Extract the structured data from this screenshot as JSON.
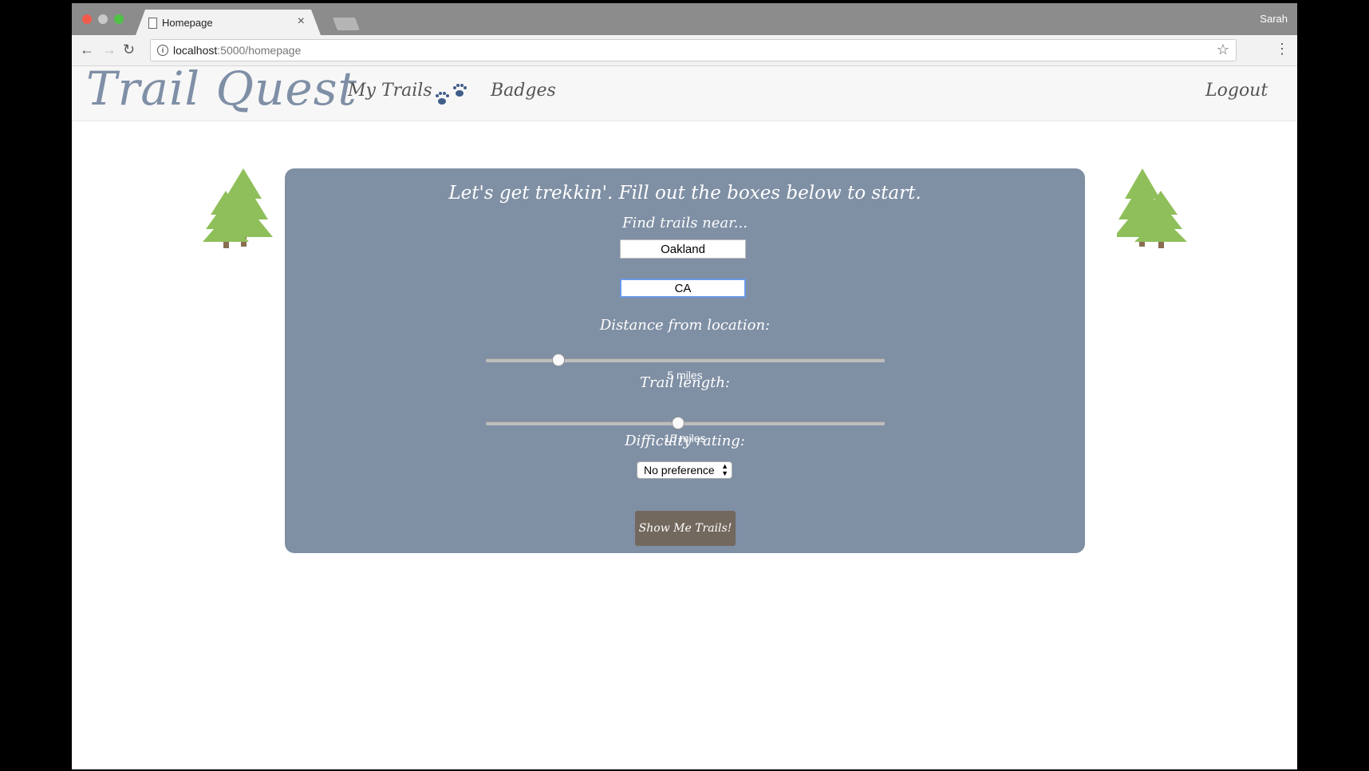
{
  "browser": {
    "tab_title": "Homepage",
    "tab_close": "×",
    "profile_name": "Sarah",
    "url_host": "localhost",
    "url_path": ":5000/homepage",
    "info_glyph": "i",
    "star_glyph": "☆",
    "menu_glyph": "⋮",
    "back_glyph": "←",
    "forward_glyph": "→",
    "reload_glyph": "↻"
  },
  "navbar": {
    "brand": "Trail Quest",
    "links": [
      "My Trails",
      "Badges",
      "Logout"
    ],
    "paw_color": "#3f5f8a"
  },
  "form": {
    "heading": "Let's get trekkin'. Fill out the boxes below to start.",
    "find_label": "Find trails near...",
    "city_value": "Oakland",
    "state_value": "CA",
    "distance_label": "Distance from location:",
    "distance_fraction": 0.18,
    "distance_value": "5 miles",
    "length_label": "Trail length:",
    "length_fraction": 0.48,
    "length_value": "15 miles",
    "difficulty_label": "Difficulty rating:",
    "difficulty_selected": "No preference",
    "submit_label": "Show Me Trails!"
  },
  "colors": {
    "card_bg": "#7f8fa4",
    "brand": "#7f8fa6",
    "button": "#73685e",
    "tree_green": "#8fbf5a",
    "trunk": "#8a6d52"
  }
}
